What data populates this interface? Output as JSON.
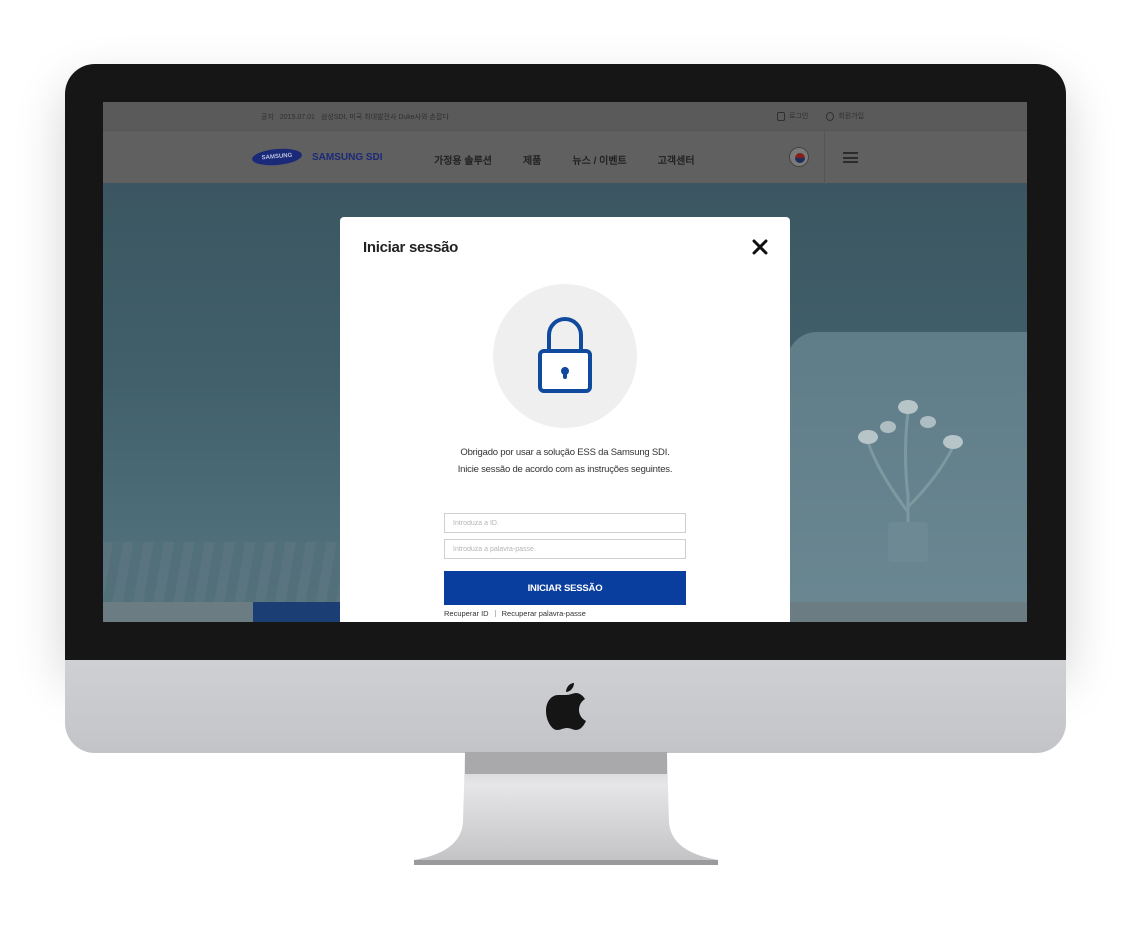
{
  "topbar": {
    "notice_prefix": "공지",
    "notice_date": "2015.07.01",
    "notice_text": "삼성SDI, 미국 최대발전사 Duke사와 손잡다",
    "login_label": "로그인",
    "signup_label": "회원가입"
  },
  "navbar": {
    "logo_mark": "SAMSUNG",
    "logo_text": "SAMSUNG SDI",
    "menu": [
      {
        "label": "가정용 솔루션"
      },
      {
        "label": "제품"
      },
      {
        "label": "뉴스 / 이벤트"
      },
      {
        "label": "고객센터"
      }
    ]
  },
  "modal": {
    "title": "Iniciar sessão",
    "intro_line1": "Obrigado por usar a solução ESS da Samsung SDI.",
    "intro_line2": "Inicie sessão de acordo com as instruções seguintes.",
    "id_placeholder": "Introduza a ID.",
    "pw_placeholder": "Introduza a palavra-passe.",
    "submit_label": "INICIAR SESSÃO",
    "recover_id": "Recuperar ID",
    "recover_pw": "Recuperar palavra-passe"
  },
  "colors": {
    "primary": "#0a3e9e",
    "lock_icon": "#0f4a9e",
    "brand_navy": "#1b2a78"
  },
  "icons": {
    "close": "close-icon",
    "lock": "lock-icon",
    "menu": "hamburger-menu-icon",
    "flag": "korea-flag-icon",
    "apple": "apple-logo-icon"
  }
}
